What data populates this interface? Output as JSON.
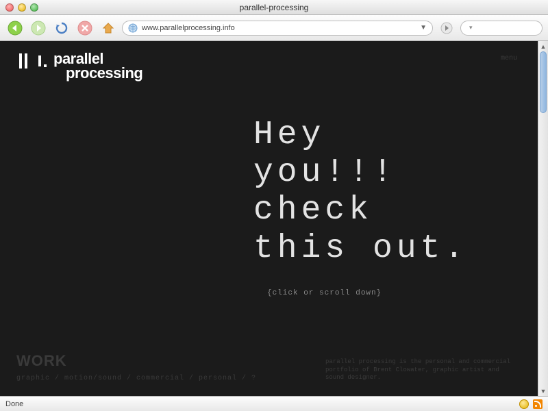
{
  "window": {
    "title": "parallel-processing"
  },
  "toolbar": {
    "url": "www.parallelprocessing.info",
    "search_placeholder": ""
  },
  "page": {
    "logo_line1": "parallel",
    "logo_line2": "processing",
    "hero_line1": "Hey",
    "hero_line2": "you!!!",
    "hero_line3": "check",
    "hero_line4": "this out.",
    "hero_sub": "{click or scroll down}",
    "section_title": "WORK",
    "section_tags": "graphic / motion/sound / commercial / personal / ?",
    "footer": "parallel processing is the personal and commercial portfolio of Brent Clowater, graphic artist and sound designer.",
    "nav_hint": "menu"
  },
  "statusbar": {
    "status": "Done"
  }
}
